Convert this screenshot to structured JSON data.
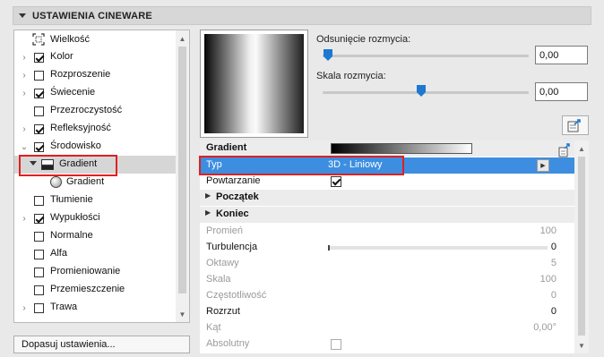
{
  "header": {
    "title": "USTAWIENIA CINEWARE"
  },
  "tree": {
    "items": [
      {
        "label": "Wielkość",
        "checked": null,
        "expandable": false,
        "icon": "resize-icon"
      },
      {
        "label": "Kolor",
        "checked": true,
        "expandable": true
      },
      {
        "label": "Rozproszenie",
        "checked": false,
        "expandable": true
      },
      {
        "label": "Świecenie",
        "checked": true,
        "expandable": true
      },
      {
        "label": "Przezroczystość",
        "checked": false,
        "expandable": false
      },
      {
        "label": "Refleksyjność",
        "checked": true,
        "expandable": true
      },
      {
        "label": "Środowisko",
        "checked": true,
        "expanded": true
      },
      {
        "label": "Gradient",
        "selected": true,
        "expanded": true,
        "icon": "gradient-shader-icon"
      },
      {
        "label": "Gradient",
        "icon": "sphere-icon"
      },
      {
        "label": "Tłumienie",
        "checked": false
      },
      {
        "label": "Wypukłości",
        "checked": true,
        "expandable": true
      },
      {
        "label": "Normalne",
        "checked": false
      },
      {
        "label": "Alfa",
        "checked": false
      },
      {
        "label": "Promieniowanie",
        "checked": false
      },
      {
        "label": "Przemieszczenie",
        "checked": false
      },
      {
        "label": "Trawa",
        "checked": false,
        "expandable": true
      }
    ]
  },
  "adjust_button": "Dopasuj ustawienia...",
  "sliders": {
    "offset": {
      "label": "Odsunięcie rozmycia:",
      "value": "0,00",
      "level": 0
    },
    "scale": {
      "label": "Skala rozmycia:",
      "value": "0,00",
      "level": 0.5
    }
  },
  "properties": {
    "gradient": {
      "name": "Gradient"
    },
    "typ": {
      "name": "Typ",
      "value": "3D - Liniowy"
    },
    "repeat": {
      "name": "Powtarzanie",
      "checked": true
    },
    "start": {
      "name": "Początek"
    },
    "end": {
      "name": "Koniec"
    },
    "radius": {
      "name": "Promień",
      "value": "100"
    },
    "turbulence": {
      "name": "Turbulencja",
      "value": "0"
    },
    "octaves": {
      "name": "Oktawy",
      "value": "5"
    },
    "scale": {
      "name": "Skala",
      "value": "100"
    },
    "frequency": {
      "name": "Częstotliwość",
      "value": "0"
    },
    "spread": {
      "name": "Rozrzut",
      "value": "0"
    },
    "angle": {
      "name": "Kąt",
      "value": "0,00°"
    },
    "absolute": {
      "name": "Absolutny",
      "checked": false
    }
  },
  "colors": {
    "selection": "#3d8ee0",
    "highlight": "#e02020",
    "slider": "#1e78d2"
  }
}
